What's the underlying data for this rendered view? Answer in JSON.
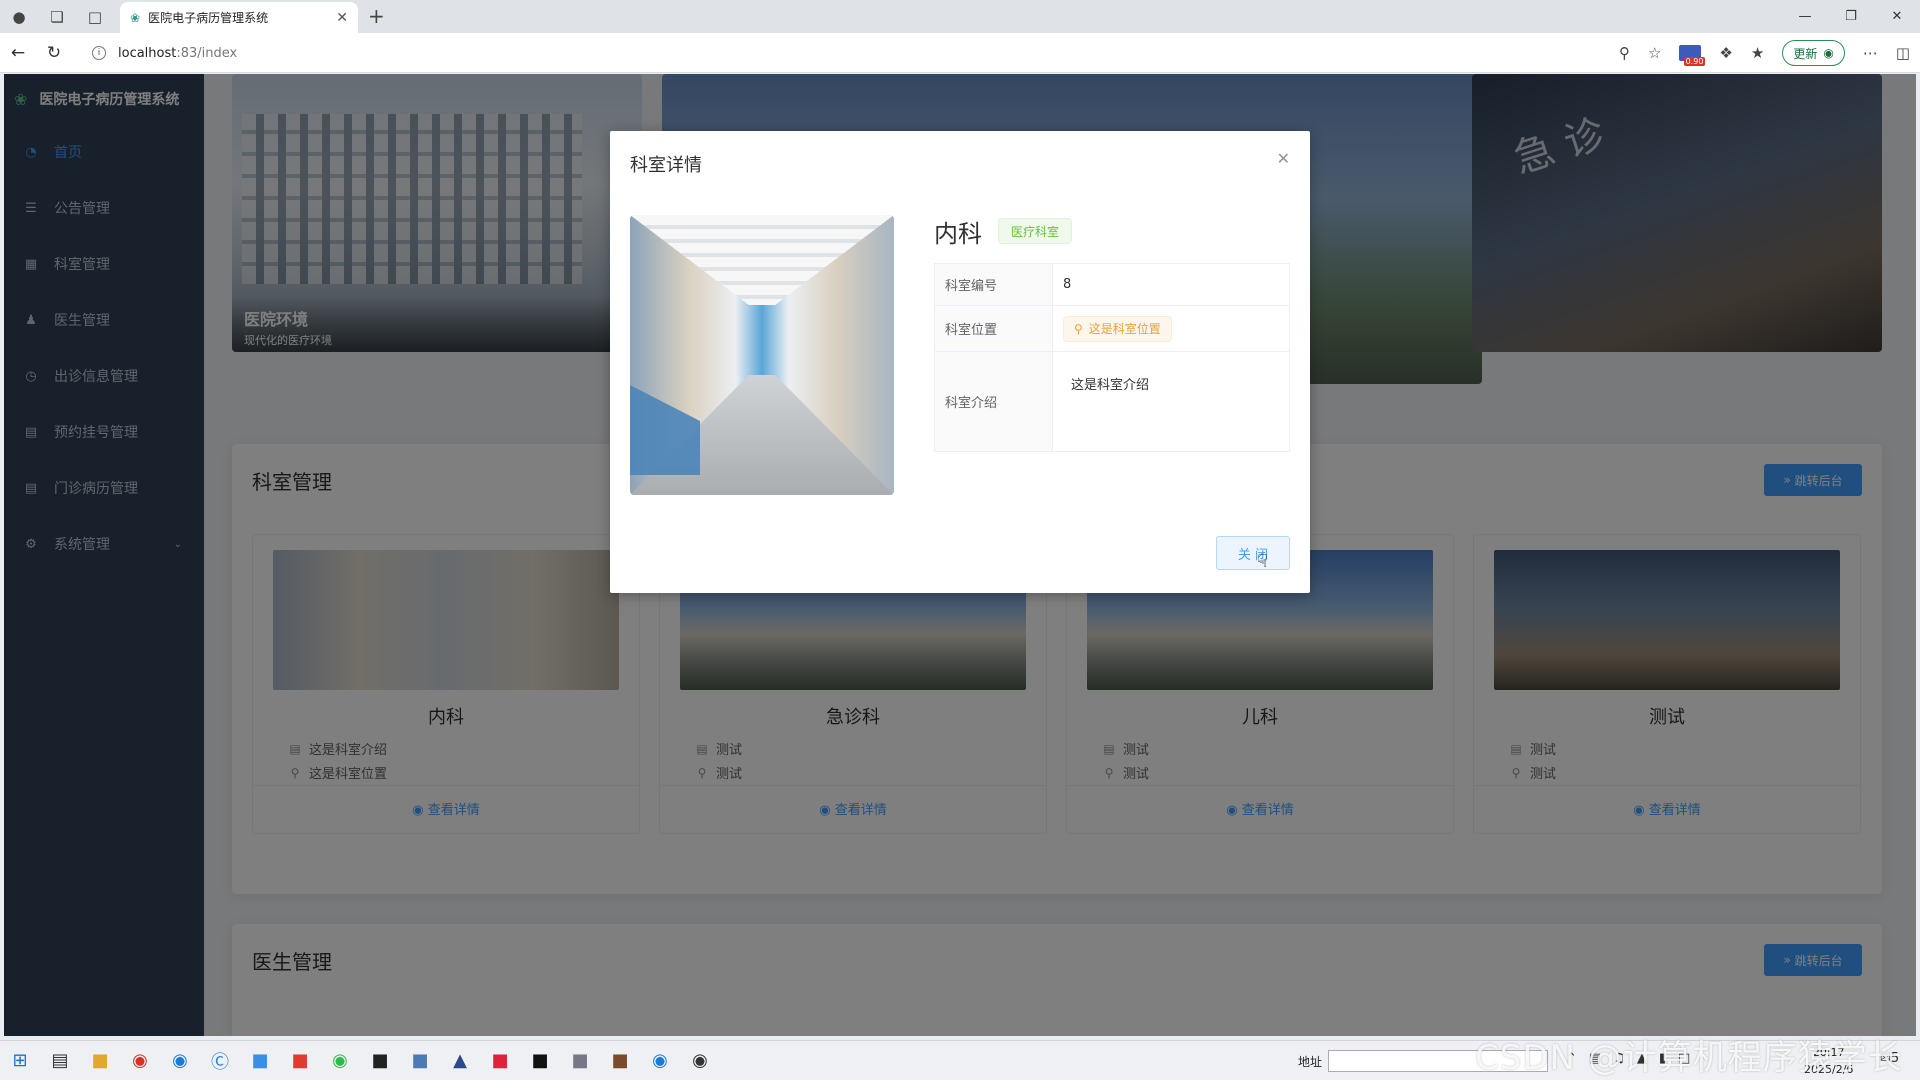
{
  "browser": {
    "tab_title": "医院电子病历管理系统",
    "url_host": "localhost",
    "url_path": ":83/index",
    "update_label": "更新",
    "badge_value": "0.90"
  },
  "sidebar": {
    "app_title": "医院电子病历管理系统",
    "items": [
      {
        "label": "首页",
        "icon": "dashboard-icon"
      },
      {
        "label": "公告管理",
        "icon": "list-icon"
      },
      {
        "label": "科室管理",
        "icon": "table-icon"
      },
      {
        "label": "医生管理",
        "icon": "user-icon"
      },
      {
        "label": "出诊信息管理",
        "icon": "clock-icon"
      },
      {
        "label": "预约挂号管理",
        "icon": "document-icon"
      },
      {
        "label": "门诊病历管理",
        "icon": "document-icon"
      },
      {
        "label": "系统管理",
        "icon": "gear-icon"
      }
    ]
  },
  "banner": {
    "caption_title": "医院环境",
    "caption_sub": "现代化的医疗环境",
    "sign_text": "急 诊"
  },
  "dept_section": {
    "title": "科室管理",
    "jump_label": "跳转后台",
    "cards": [
      {
        "name": "内科",
        "intro": "这是科室介绍",
        "location": "这是科室位置",
        "view": "查看详情"
      },
      {
        "name": "急诊科",
        "intro": "测试",
        "location": "测试",
        "view": "查看详情"
      },
      {
        "name": "儿科",
        "intro": "测试",
        "location": "测试",
        "view": "查看详情"
      },
      {
        "name": "测试",
        "intro": "测试",
        "location": "测试",
        "view": "查看详情"
      }
    ]
  },
  "doctor_section": {
    "title": "医生管理",
    "jump_label": "跳转后台"
  },
  "dialog": {
    "title": "科室详情",
    "dept_name": "内科",
    "tag": "医疗科室",
    "rows": {
      "id_label": "科室编号",
      "id_value": "8",
      "loc_label": "科室位置",
      "loc_value": "这是科室位置",
      "intro_label": "科室介绍",
      "intro_value": "这是科室介绍"
    },
    "close_label": "关 闭"
  },
  "taskbar": {
    "address_label": "地址",
    "time": "20:17",
    "date": "2025/2/6",
    "notif_count": "5"
  },
  "watermark": "CSDN @计算机程序猿学长",
  "colors": {
    "sidebar_bg": "#304156",
    "primary": "#409eff",
    "success": "#67c23a",
    "warning": "#e6a23c"
  }
}
